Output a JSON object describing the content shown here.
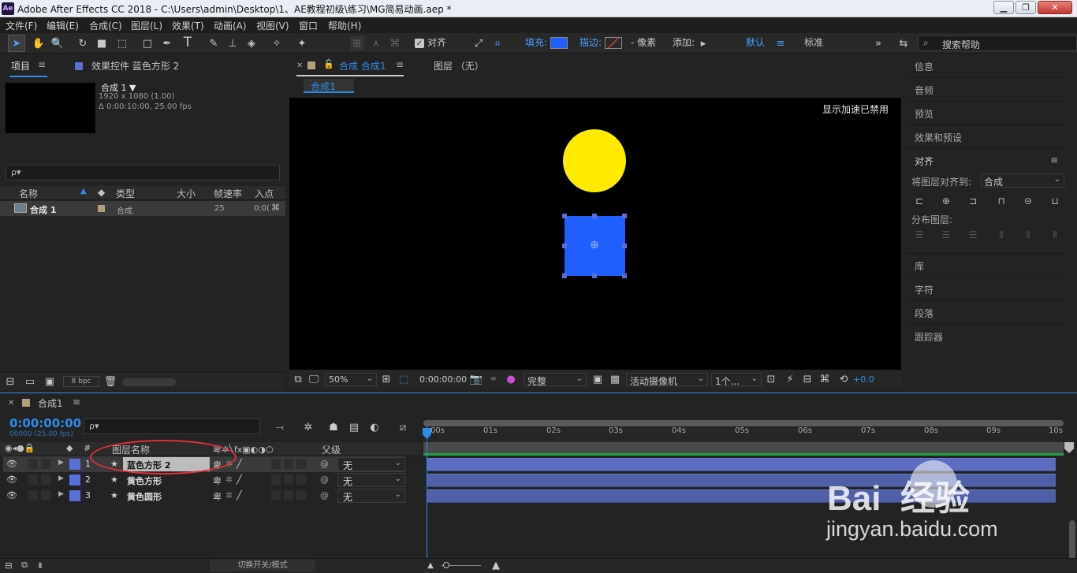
{
  "window": {
    "logo": "Ae",
    "title": "Adobe After Effects CC 2018 - C:\\Users\\admin\\Desktop\\1、AE教程初级\\练习\\MG简易动画.aep *"
  },
  "menus": [
    "文件(F)",
    "编辑(E)",
    "合成(C)",
    "图层(L)",
    "效果(T)",
    "动画(A)",
    "视图(V)",
    "窗口",
    "帮助(H)"
  ],
  "toolbar": {
    "align_label": "对齐",
    "fill_label": "填充:",
    "stroke_label": "描边:",
    "pixels_label": "- 像素",
    "add_label": "添加:",
    "workspace_default": "默认",
    "workspace_standard": "标准",
    "search_placeholder": "搜索帮助",
    "colors": {
      "fill": "#1f5eff",
      "stroke": "#c0392b"
    }
  },
  "project_panel": {
    "tab_project": "项目",
    "tab_effects": "效果控件 蓝色方形 2",
    "comp_name": "合成 1 ▼",
    "comp_res": "1920 x 1080 (1.00)",
    "comp_duration": "Δ 0:00:10:00, 25.00 fps",
    "search_placeholder": "ρ▾",
    "columns": [
      "名称",
      "类型",
      "大小",
      "帧速率",
      "入点"
    ],
    "items": [
      {
        "name": "合成 1",
        "type": "合成",
        "size": "",
        "fps": "25",
        "in": "0:0("
      }
    ],
    "bpc": "8 bpc"
  },
  "viewer": {
    "tab_comp": "合成 合成1",
    "tab_layer": "图层 （无）",
    "breadcrumb": "合成1",
    "gpu_notice": "显示加速已禁用",
    "zoom": "50%",
    "timecode": "0:00:00:00",
    "quality": "完整",
    "camera": "活动摄像机",
    "views": "1个...",
    "exposure": "+0.0",
    "colors": {
      "circle": "#ffea00",
      "square": "#1f5eff"
    }
  },
  "right_panel": {
    "items_top": [
      "信息",
      "音频",
      "预览",
      "效果和预设"
    ],
    "align_title": "对齐",
    "align_to_label": "将图层对齐到:",
    "align_to_value": "合成",
    "distribute_label": "分布图层:",
    "items_bottom": [
      "库",
      "字符",
      "段落",
      "跟踪器"
    ]
  },
  "timeline": {
    "tab": "合成1",
    "timecode": "0:00:00:00",
    "frames": "00000 (25.00 fps)",
    "search_placeholder": "ρ▾",
    "col_number": "#",
    "col_layer_name": "图层名称",
    "col_parent": "父级",
    "toggle_label": "切换开关/模式",
    "layers": [
      {
        "num": "1",
        "name": "蓝色方形 2",
        "parent": "无",
        "selected": true
      },
      {
        "num": "2",
        "name": "黄色方形",
        "parent": "无",
        "selected": false
      },
      {
        "num": "3",
        "name": "黄色圆形",
        "parent": "无",
        "selected": false
      }
    ],
    "ruler": [
      "00s",
      "01s",
      "02s",
      "03s",
      "04s",
      "05s",
      "06s",
      "07s",
      "08s",
      "09s",
      "10s"
    ],
    "label_color": "#5a6fd6"
  },
  "watermark": {
    "brand": "Bai  经验",
    "url": "jingyan.baidu.com"
  }
}
